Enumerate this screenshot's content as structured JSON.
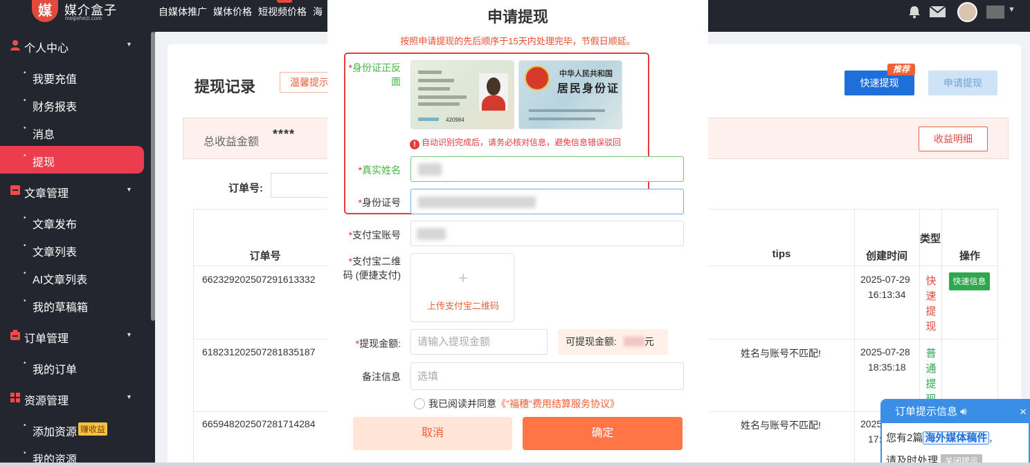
{
  "header": {
    "logo_mark": "媒",
    "logo_text": "媒介盒子",
    "logo_sub": "meijiehezi.com",
    "nav": [
      "自媒体推广",
      "媒体价格",
      "短视频价格",
      "海"
    ]
  },
  "sidebar": {
    "groups": [
      {
        "label": "个人中心",
        "icon": "user-icon"
      },
      {
        "label": "文章管理",
        "icon": "document-icon"
      },
      {
        "label": "订单管理",
        "icon": "order-icon"
      },
      {
        "label": "资源管理",
        "icon": "grid-icon"
      }
    ],
    "items": {
      "recharge": "我要充值",
      "finance": "财务报表",
      "messages": "消息",
      "withdraw": "提现",
      "article_publish": "文章发布",
      "article_list": "文章列表",
      "ai_article_list": "AI文章列表",
      "drafts": "我的草稿箱",
      "my_orders": "我的订单",
      "add_resource": "添加资源",
      "add_resource_badge": "赚收益",
      "my_resources": "我的资源"
    }
  },
  "page": {
    "title": "提现记录",
    "tip_button": "温馨提示",
    "quick_button": "快速提现",
    "quick_tag": "推荐",
    "apply_button": "申请提现",
    "income_label": "总收益金额",
    "income_value": "****",
    "detail_button": "收益明细",
    "order_filter_label": "订单号:"
  },
  "table": {
    "headers": {
      "order": "订单号",
      "tips": "tips",
      "created": "创建时间",
      "type": "类型",
      "action": "操作"
    },
    "rows": [
      {
        "order": "662329202507291613332",
        "tips": "",
        "date": "2025-07-29",
        "time": "16:13:34",
        "type": "快速提现",
        "type_color": "#e24a3c",
        "action": "快速信息"
      },
      {
        "order": "618231202507281835187",
        "tips": "姓名与账号不匹配!",
        "date": "2025-07-28",
        "time": "18:35:18",
        "type": "普通提现",
        "type_color": "#2ea84f",
        "action": ""
      },
      {
        "order": "665948202507281714284",
        "tips": "姓名与账号不匹配!",
        "date": "2025",
        "time": "17:",
        "type": "",
        "type_color": "#333333",
        "action": ""
      }
    ]
  },
  "modal": {
    "title": "申请提现",
    "subtitle": "按照申请提现的先后顺序于15天内处理完毕，节假日顺延。",
    "id_label": "身份证正反面",
    "id_front_number": "420984",
    "id_back_line1": "中华人民共和国",
    "id_back_line2": "居民身份证",
    "warning": "自动识别完成后，请务必核对信息，避免信息错误驳回",
    "name_label": "真实姓名",
    "idno_label": "身份证号",
    "alipay_label": "支付宝账号",
    "qr_label": "支付宝二维码 (便捷支付)",
    "qr_upload_plus": "+",
    "qr_upload_text": "上传支付宝二维码",
    "amount_label": "提现金额:",
    "amount_placeholder": "请输入提现金额",
    "available_label": "可提现金额:",
    "available_unit": "元",
    "remark_label": "备注信息",
    "remark_placeholder": "选填",
    "agree_text": "我已阅读并同意",
    "agree_link": "《\"福穗\"费用结算服务协议》",
    "cancel_button": "取消",
    "confirm_button": "确定",
    "required_mark": "*"
  },
  "notice": {
    "title": "订单提示信息",
    "body_prefix": "您有2篇",
    "body_link": "海外媒体稿件",
    "body_suffix": ",",
    "body_line2": "请及时处理",
    "close_button": "关闭提示",
    "close_x": "×"
  },
  "colors": {
    "brand_red": "#e24a3c",
    "accent_orange": "#ff7545",
    "sidebar_bg": "#23262e",
    "active_item": "#ec3d4e",
    "primary_blue": "#1e6fd9",
    "label_green": "#42b642"
  }
}
